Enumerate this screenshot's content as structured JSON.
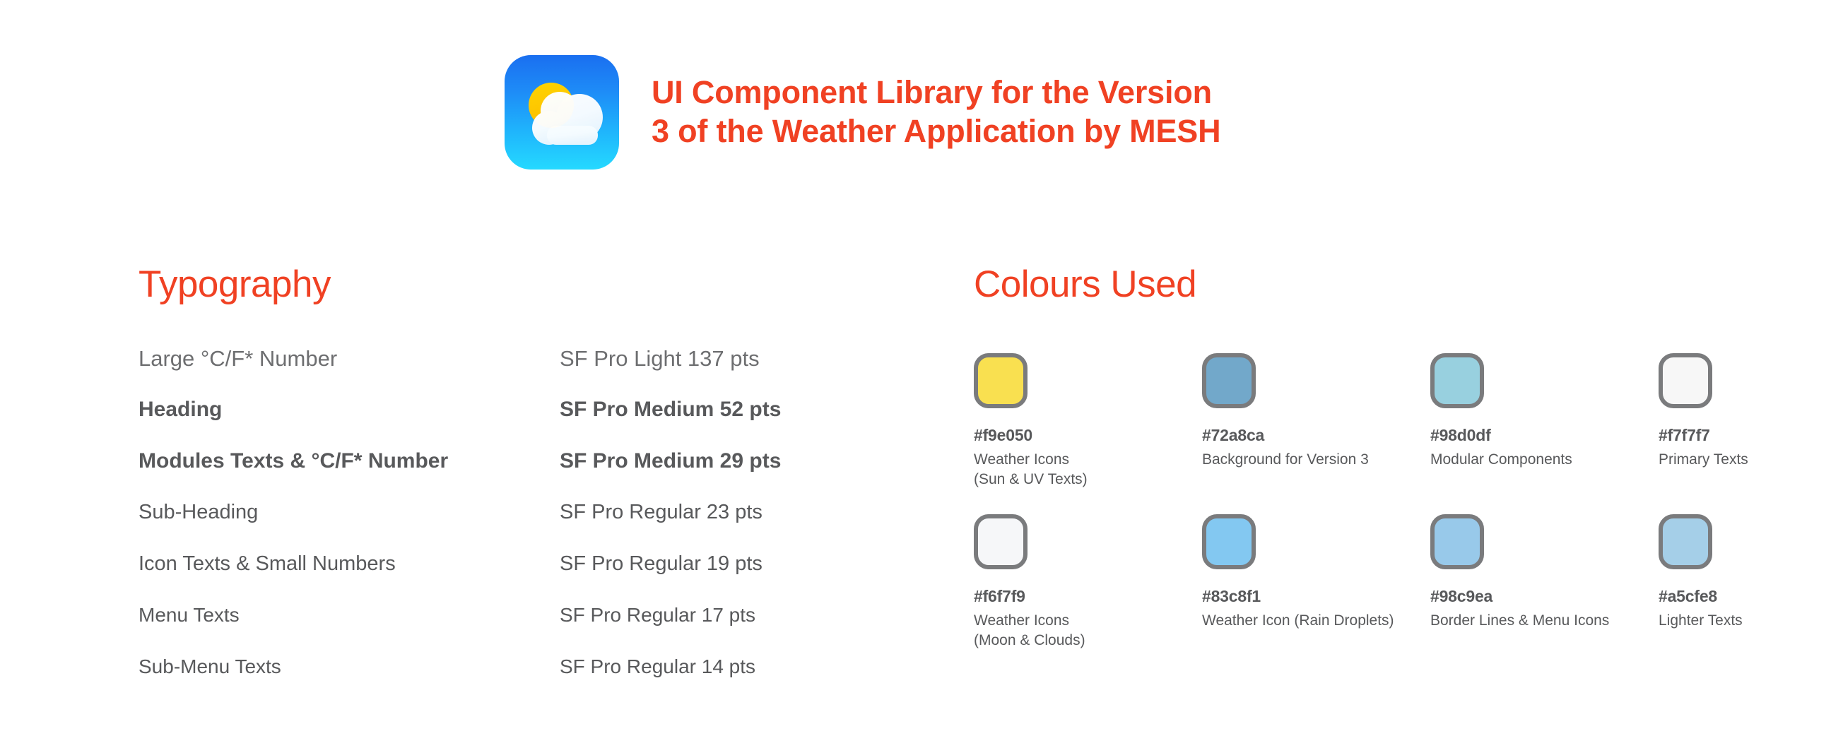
{
  "header": {
    "app_icon_name": "weather-app-icon",
    "title": "UI Component Library for the Version\n3 of the Weather Application by MESH",
    "title_color": "#f04123",
    "icon_gradient_top": "#1a6ff0",
    "icon_gradient_bottom": "#25d9ff",
    "icon_sun_color": "#fdc800",
    "icon_cloud_color": "#ffffff"
  },
  "typography": {
    "heading": "Typography",
    "rows": [
      {
        "label": "Large °C/F* Number",
        "spec": "SF Pro Light 137 pts"
      },
      {
        "label": "Heading",
        "spec": "SF Pro Medium 52 pts"
      },
      {
        "label": "Modules Texts & °C/F* Number",
        "spec": "SF Pro Medium 29 pts"
      },
      {
        "label": "Sub-Heading",
        "spec": "SF Pro Regular 23 pts"
      },
      {
        "label": "Icon Texts & Small Numbers",
        "spec": "SF Pro Regular 19 pts"
      },
      {
        "label": "Menu Texts",
        "spec": "SF Pro Regular 17 pts"
      },
      {
        "label": "Sub-Menu Texts",
        "spec": "SF Pro Regular 14 pts"
      }
    ]
  },
  "colours": {
    "heading": "Colours Used",
    "swatches": [
      {
        "hex": "#f9e050",
        "desc": "Weather Icons\n(Sun & UV Texts)"
      },
      {
        "hex": "#72a8ca",
        "desc": "Background for Version 3"
      },
      {
        "hex": "#98d0df",
        "desc": "Modular Components"
      },
      {
        "hex": "#f7f7f7",
        "desc": "Primary Texts"
      },
      {
        "hex": "#f6f7f9",
        "desc": "Weather Icons\n(Moon & Clouds)"
      },
      {
        "hex": "#83c8f1",
        "desc": "Weather Icon (Rain Droplets)"
      },
      {
        "hex": "#98c9ea",
        "desc": "Border Lines & Menu Icons"
      },
      {
        "hex": "#a5cfe8",
        "desc": "Lighter Texts"
      }
    ]
  }
}
